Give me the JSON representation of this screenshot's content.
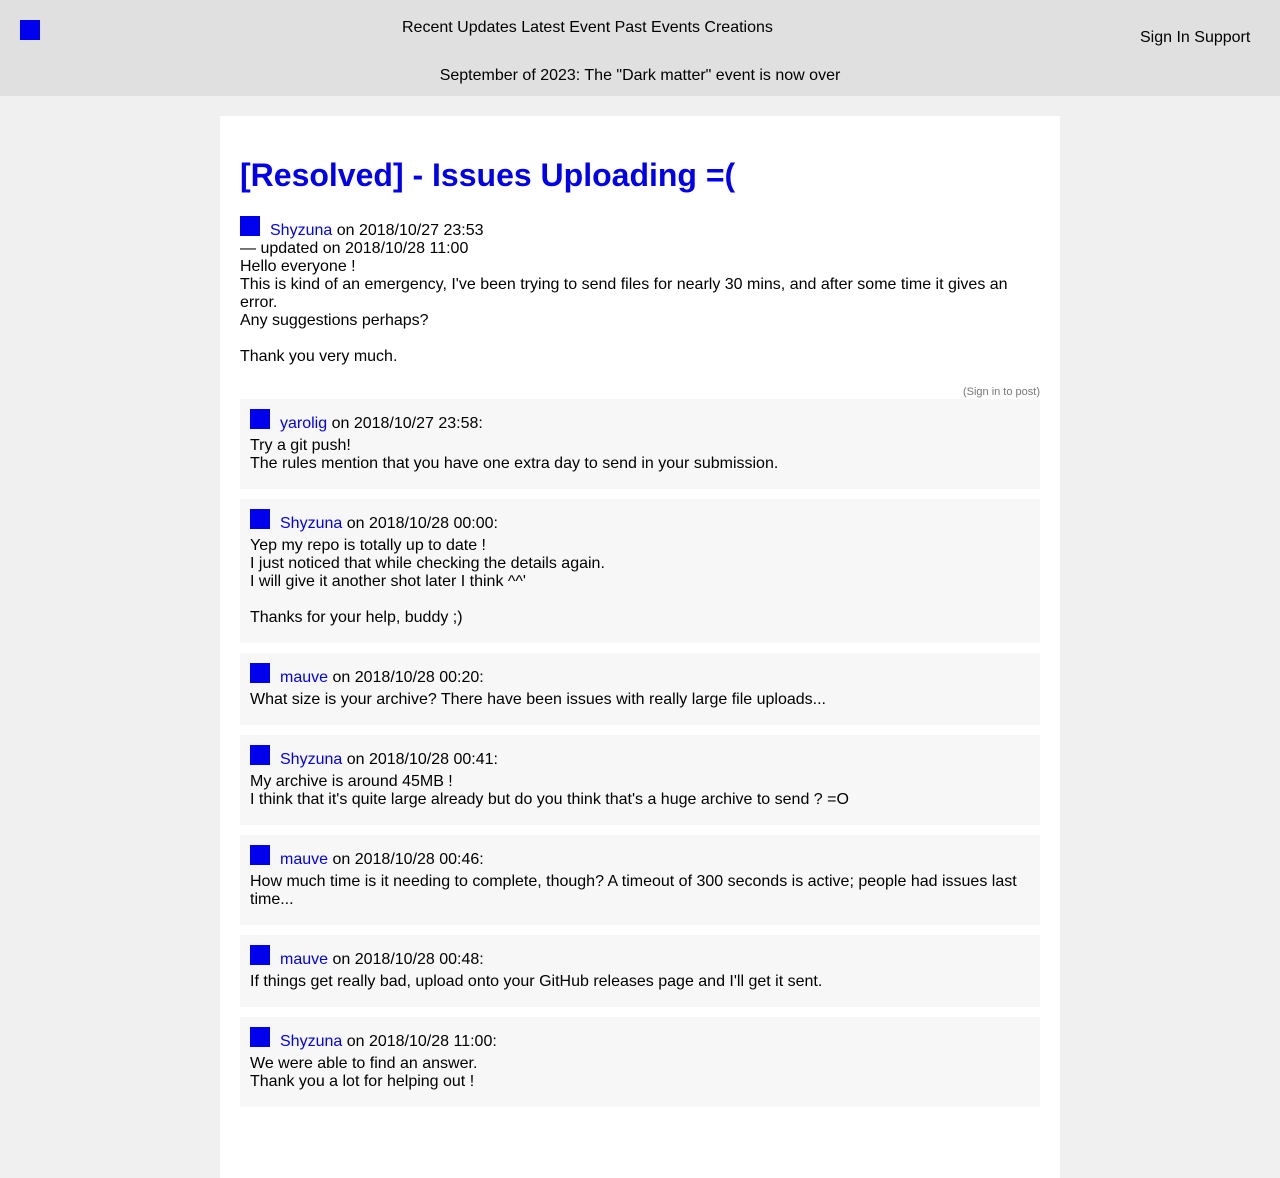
{
  "header": {
    "nav": [
      "Recent Updates",
      "Latest Event",
      "Past Events",
      "Creations"
    ],
    "auth": [
      "Sign In",
      "Support"
    ],
    "announcement": "September of 2023: The \"Dark matter\" event is now over"
  },
  "post": {
    "title": "[Resolved] - Issues Uploading =(",
    "author": "Shyzuna",
    "date_text": "on 2018/10/27 23:53",
    "updated_text": "— updated on 2018/10/28 11:00",
    "body_lines_1": [
      "Hello everyone !",
      "This is kind of an emergency, I've been trying to send files for nearly 30 mins, and after some time it gives an error.",
      "Any suggestions perhaps?"
    ],
    "body_lines_2": [
      "Thank you very much."
    ],
    "signin_hint": "(Sign in to post)"
  },
  "comments": [
    {
      "author": "yarolig",
      "date_text": "on 2018/10/27 23:58:",
      "lines_1": [
        "Try a git push!",
        "The rules mention that you have one extra day to send in your submission."
      ]
    },
    {
      "author": "Shyzuna",
      "date_text": "on 2018/10/28 00:00:",
      "lines_1": [
        "Yep my repo is totally up to date !",
        "I just noticed that while checking the details again.",
        "I will give it another shot later I think ^^'"
      ],
      "lines_2": [
        "Thanks for your help, buddy ;)"
      ]
    },
    {
      "author": "mauve",
      "date_text": "on 2018/10/28 00:20:",
      "lines_1": [
        "What size is your archive? There have been issues with really large file uploads..."
      ]
    },
    {
      "author": "Shyzuna",
      "date_text": "on 2018/10/28 00:41:",
      "lines_1": [
        "My archive is around 45MB !",
        "I think that it's quite large already but do you think that's a huge archive to send ? =O"
      ]
    },
    {
      "author": "mauve",
      "date_text": "on 2018/10/28 00:46:",
      "lines_1": [
        "How much time is it needing to complete, though? A timeout of 300 seconds is active; people had issues last time..."
      ]
    },
    {
      "author": "mauve",
      "date_text": "on 2018/10/28 00:48:",
      "lines_1": [
        "If things get really bad, upload onto your GitHub releases page and I'll get it sent."
      ]
    },
    {
      "author": "Shyzuna",
      "date_text": "on 2018/10/28 11:00:",
      "lines_1": [
        "We were able to find an answer.",
        "Thank you a lot for helping out !"
      ]
    }
  ]
}
